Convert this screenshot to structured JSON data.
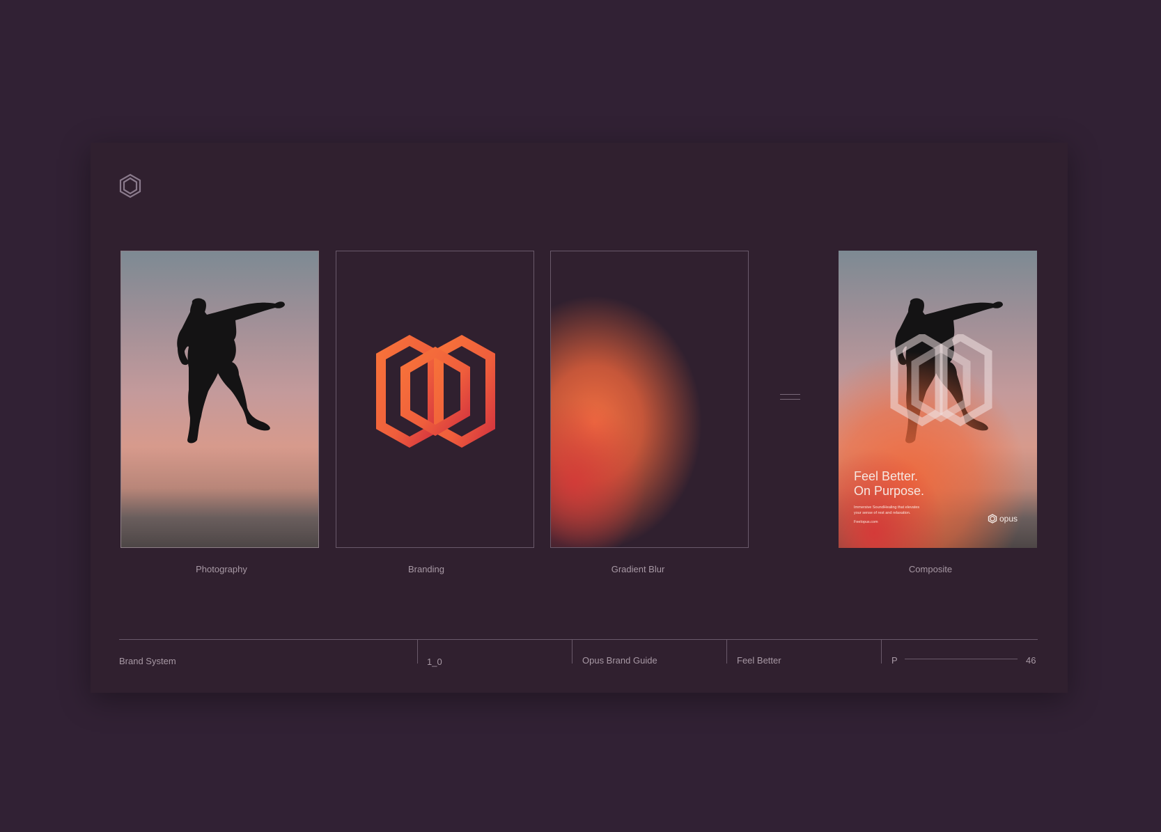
{
  "panels": [
    {
      "caption": "Photography"
    },
    {
      "caption": "Branding"
    },
    {
      "caption": "Gradient Blur"
    },
    {
      "caption": "Composite"
    }
  ],
  "composite": {
    "tagline": "Feel Better.\nOn Purpose.",
    "subcopy": "Immersive SoundHealing that elevates\nyour sense of rest and relaxation.",
    "url": "Feelopus.com",
    "brand_name": "opus"
  },
  "footer": {
    "section": "Brand System",
    "version": "1_0",
    "document": "Opus Brand Guide",
    "tagline": "Feel Better",
    "page_prefix": "P",
    "page_number": "46"
  },
  "colors": {
    "background": "#312134",
    "accent_orange": "#f26a3b",
    "accent_red": "#d93a3a",
    "muted_text": "#a899a5"
  },
  "icons": [
    "hexagon-logo-icon",
    "equals-icon"
  ]
}
